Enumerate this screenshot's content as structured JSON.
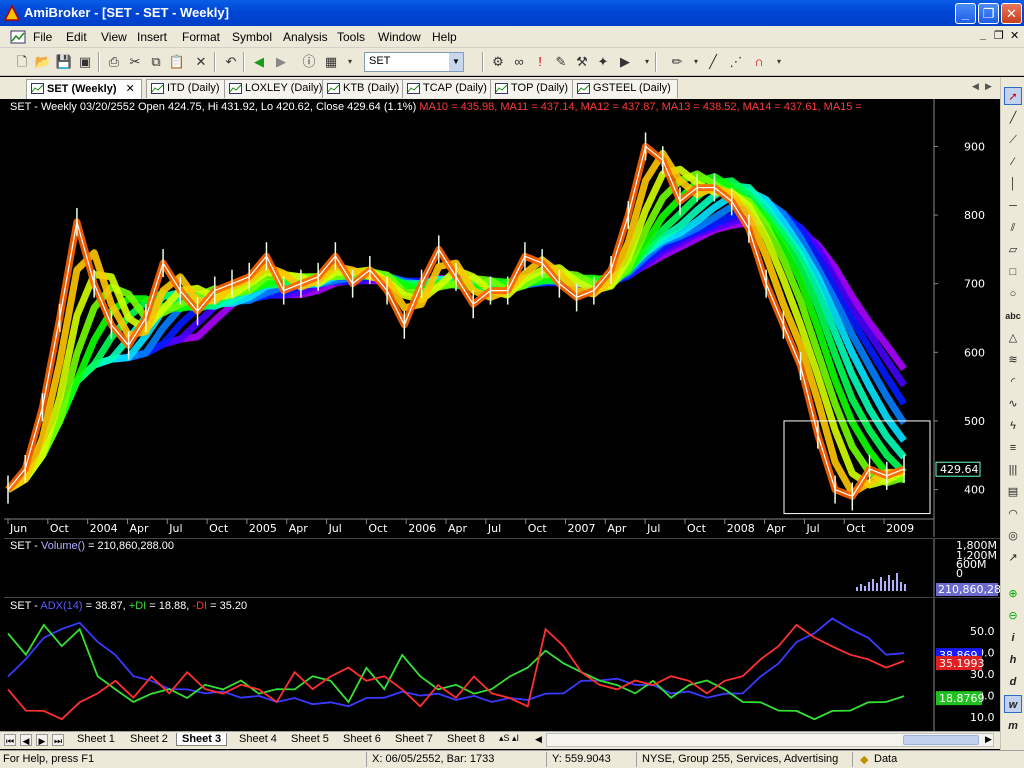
{
  "window": {
    "title": "AmiBroker - [SET - SET - Weekly]",
    "min": "_",
    "restore": "❐",
    "close": "✕"
  },
  "menu": [
    "File",
    "Edit",
    "View",
    "Insert",
    "Format",
    "Symbol",
    "Analysis",
    "Tools",
    "Window",
    "Help"
  ],
  "toolbar": {
    "symbol_value": "SET"
  },
  "tabs": [
    {
      "label": "SET (Weekly)",
      "close": "✕"
    },
    {
      "label": "ITD (Daily)"
    },
    {
      "label": "LOXLEY (Daily)"
    },
    {
      "label": "KTB (Daily)"
    },
    {
      "label": "TCAP (Daily)"
    },
    {
      "label": "TOP (Daily)"
    },
    {
      "label": "GSTEEL (Daily)"
    }
  ],
  "price_pane": {
    "title_prefix": "SET - Weekly 03/20/2552 Open 424.75, Hi 431.92, Lo 420.62, Close 429.64 (1.1%)",
    "ma": [
      {
        "text": "MA10 = 435.98,",
        "color": "#ff3b3b"
      },
      {
        "text": "MA11 = 437.14,",
        "color": "#ff3b3b"
      },
      {
        "text": "MA12 = 437.87,",
        "color": "#ff3b3b"
      },
      {
        "text": "MA13 = 438.52,",
        "color": "#ff3b3b"
      },
      {
        "text": "MA14 = 437.61,",
        "color": "#ff3b3b"
      },
      {
        "text": "MA15 =",
        "color": "#ff3b3b"
      }
    ],
    "y_ticks": [
      "900",
      "800",
      "700",
      "600",
      "500",
      "400"
    ],
    "last_value": "429.64",
    "x_ticks": [
      "Jun",
      "Oct",
      "2004",
      "Apr",
      "Jul",
      "Oct",
      "2005",
      "Apr",
      "Jul",
      "Oct",
      "2006",
      "Apr",
      "Jul",
      "Oct",
      "2007",
      "Apr",
      "Jul",
      "Oct",
      "2008",
      "Apr",
      "Jul",
      "Oct",
      "2009"
    ]
  },
  "volume_pane": {
    "title": "SET -",
    "func": "Volume()",
    "value_text": "= 210,860,288.00",
    "y_ticks": [
      "1,800M",
      "1,200M",
      "600M",
      "0"
    ],
    "last_value": "210,860,28"
  },
  "adx_pane": {
    "title": "SET -",
    "adx": {
      "text": "ADX(14)",
      "value": "= 38.87,",
      "color": "#3a3aff"
    },
    "pdi": {
      "text": "+DI",
      "value": "= 18.88,",
      "color": "#35e035"
    },
    "mdi": {
      "text": "-DI",
      "value": "= 35.20",
      "color": "#ff3030"
    },
    "y_ticks": [
      "50.0",
      "40.0",
      "30.0",
      "20.0",
      "10.0"
    ],
    "last_values": [
      {
        "text": "38.869",
        "color": "#1a1aff"
      },
      {
        "text": "35.1993",
        "color": "#e02020"
      },
      {
        "text": "18.8769",
        "color": "#20c020"
      }
    ]
  },
  "sheets": [
    "Sheet 1",
    "Sheet 2",
    "Sheet 3",
    "Sheet 4",
    "Sheet 5",
    "Sheet 6",
    "Sheet 7",
    "Sheet 8"
  ],
  "sheets_extra": "▴S  ▴I",
  "status": {
    "help": "For Help, press F1",
    "x": "X: 06/05/2552, Bar: 1733",
    "y": "Y: 559.9043",
    "info": "NYSE, Group 255, Services, Advertising",
    "data": "Data"
  },
  "chart_data": [
    {
      "type": "line",
      "title": "SET - Weekly",
      "ylim": [
        360,
        940
      ],
      "y_ticks": [
        900,
        800,
        700,
        600,
        500,
        400
      ],
      "x": [
        "Jun",
        "Oct",
        "2004",
        "Apr",
        "Jul",
        "Oct",
        "2005",
        "Apr",
        "Jul",
        "Oct",
        "2006",
        "Apr",
        "Jul",
        "Oct",
        "2007",
        "Apr",
        "Jul",
        "Oct",
        "2008",
        "Apr",
        "Jul",
        "Oct",
        "2009"
      ],
      "series": [
        {
          "name": "Close",
          "values": [
            400,
            430,
            520,
            650,
            790,
            700,
            640,
            610,
            650,
            730,
            690,
            660,
            690,
            700,
            710,
            740,
            690,
            700,
            710,
            740,
            700,
            720,
            690,
            640,
            700,
            750,
            710,
            670,
            690,
            690,
            740,
            730,
            700,
            680,
            690,
            720,
            800,
            900,
            880,
            820,
            840,
            840,
            820,
            780,
            700,
            640,
            580,
            480,
            400,
            390,
            430,
            420,
            430
          ]
        }
      ],
      "last": 429.64
    },
    {
      "type": "bar",
      "title": "SET - Volume()",
      "value": 210860288.0,
      "y_ticks": [
        1800,
        1200,
        600,
        0
      ],
      "unit": "M"
    },
    {
      "type": "line",
      "title": "SET - ADX(14), +DI, -DI",
      "ylim": [
        5,
        58
      ],
      "y_ticks": [
        50,
        40,
        30,
        20,
        10
      ],
      "series": [
        {
          "name": "ADX(14)",
          "values": [
            28,
            38,
            46,
            52,
            53,
            46,
            38,
            30,
            26,
            24,
            22,
            22,
            21,
            20,
            19,
            18,
            18,
            17,
            16,
            16,
            18,
            20,
            21,
            21,
            20,
            19,
            19,
            18,
            18,
            19,
            20,
            22,
            26,
            28,
            27,
            26,
            24,
            22,
            21,
            20,
            20,
            22,
            28,
            36,
            44,
            50,
            55,
            52,
            46,
            40,
            38.87
          ],
          "color": "#3a3aff"
        },
        {
          "name": "+DI",
          "values": [
            48,
            40,
            52,
            44,
            50,
            30,
            22,
            18,
            20,
            24,
            18,
            26,
            22,
            28,
            20,
            24,
            22,
            30,
            26,
            18,
            32,
            24,
            38,
            30,
            22,
            26,
            20,
            24,
            28,
            34,
            40,
            36,
            30,
            28,
            24,
            22,
            26,
            20,
            24,
            28,
            22,
            18,
            16,
            14,
            12,
            10,
            12,
            14,
            16,
            18,
            18.88
          ],
          "color": "#35e035"
        },
        {
          "name": "-DI",
          "values": [
            22,
            14,
            12,
            10,
            16,
            22,
            26,
            20,
            28,
            22,
            30,
            24,
            20,
            26,
            22,
            18,
            30,
            24,
            28,
            34,
            26,
            30,
            22,
            16,
            24,
            20,
            28,
            22,
            18,
            16,
            50,
            44,
            30,
            26,
            22,
            28,
            24,
            30,
            26,
            22,
            26,
            30,
            36,
            44,
            52,
            48,
            42,
            40,
            36,
            34,
            35.2
          ],
          "color": "#ff3030"
        }
      ]
    }
  ]
}
